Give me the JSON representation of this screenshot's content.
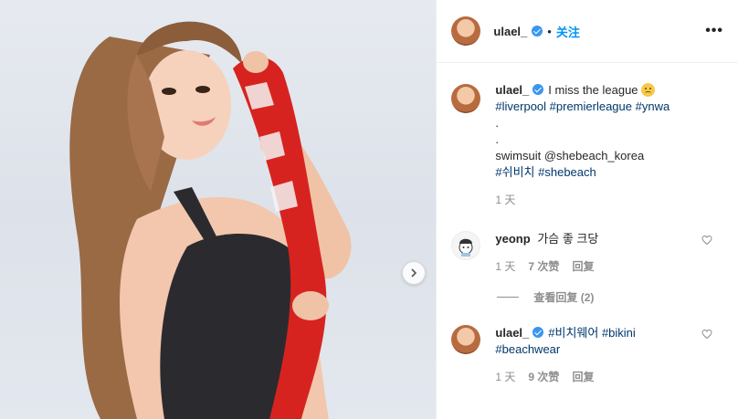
{
  "post": {
    "username": "ulael_",
    "follow_label": "关注",
    "separator": "•",
    "more_label": "•••"
  },
  "caption": {
    "username": "ulael_",
    "text": "I miss the league",
    "tags_line1": "#liverpool #premierleague #ynwa",
    "dot1": ".",
    "dot2": ".",
    "line_swimsuit": "swimsuit @shebeach_korea",
    "tags_line2": "#쉬비치 #shebeach",
    "time": "1 天"
  },
  "comments": [
    {
      "username": "yeonp",
      "text": "가슴 좋 크당",
      "time": "1 天",
      "likes": "7 次赞",
      "reply": "回复"
    },
    {
      "username": "ulael_",
      "text_line1": "#비치웨어 #bikini",
      "text_line2": "#beachwear",
      "time": "1 天",
      "likes": "9 次赞",
      "reply": "回复"
    }
  ],
  "view_replies": "查看回复 (2)",
  "colors": {
    "accent": "#0095f6",
    "verified": "#3897f0",
    "hashtag": "#00376b",
    "muted": "#8e8e8e"
  },
  "icons": [
    "verified-badge-icon",
    "more-options-icon",
    "heart-icon",
    "chevron-right-icon"
  ]
}
